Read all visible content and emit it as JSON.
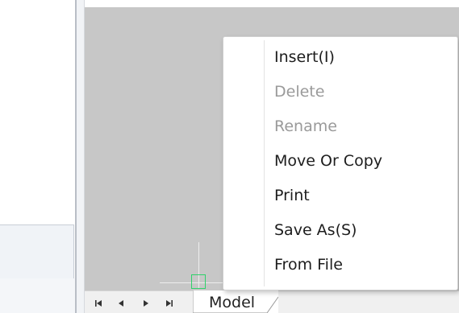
{
  "sheet_nav": {
    "first_icon": "first-sheet-icon",
    "prev_icon": "prev-sheet-icon",
    "next_icon": "next-sheet-icon",
    "last_icon": "last-sheet-icon"
  },
  "tabs": [
    {
      "label": "Model",
      "active": true
    }
  ],
  "context_menu": {
    "items": [
      {
        "label": "Insert(I)",
        "enabled": true
      },
      {
        "label": "Delete",
        "enabled": false
      },
      {
        "label": "Rename",
        "enabled": false
      },
      {
        "label": "Move Or Copy",
        "enabled": true
      },
      {
        "label": "Print",
        "enabled": true
      },
      {
        "label": "Save As(S)",
        "enabled": true
      },
      {
        "label": "From File",
        "enabled": true
      }
    ]
  },
  "colors": {
    "canvas": "#c7c7c7",
    "cursor": "#2ed26a",
    "disabled_text": "#9a9a9a"
  }
}
